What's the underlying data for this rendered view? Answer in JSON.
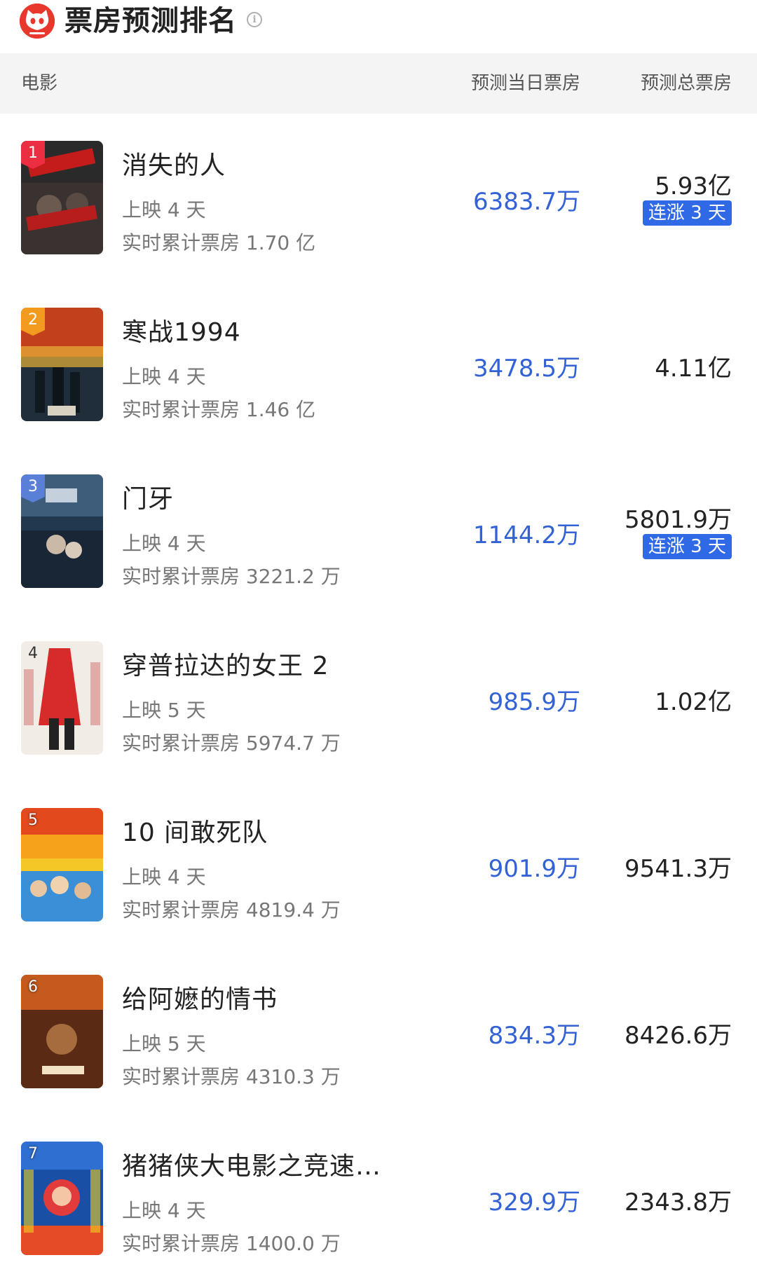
{
  "header": {
    "title": "票房预测排名",
    "info_icon": "info-icon"
  },
  "columns": {
    "movie": "电影",
    "day": "预测当日票房",
    "total": "预测总票房"
  },
  "colors": {
    "accent_blue": "#3262d6",
    "badge_blue": "#3069e6",
    "logo_red": "#e8372c"
  },
  "movies": [
    {
      "rank": "1",
      "name": "消失的人",
      "days": "上映 4 天",
      "cumulative": "实时累计票房 1.70 亿",
      "day_box": "6383.7万",
      "total_box": "5.93亿",
      "badge": "连涨 3 天"
    },
    {
      "rank": "2",
      "name": "寒战1994",
      "days": "上映 4 天",
      "cumulative": "实时累计票房 1.46 亿",
      "day_box": "3478.5万",
      "total_box": "4.11亿",
      "badge": ""
    },
    {
      "rank": "3",
      "name": "门牙",
      "days": "上映 4 天",
      "cumulative": "实时累计票房 3221.2 万",
      "day_box": "1144.2万",
      "total_box": "5801.9万",
      "badge": "连涨 3 天"
    },
    {
      "rank": "4",
      "name": "穿普拉达的女王 2",
      "days": "上映 5 天",
      "cumulative": "实时累计票房 5974.7 万",
      "day_box": "985.9万",
      "total_box": "1.02亿",
      "badge": ""
    },
    {
      "rank": "5",
      "name": "10 间敢死队",
      "days": "上映 4 天",
      "cumulative": "实时累计票房 4819.4 万",
      "day_box": "901.9万",
      "total_box": "9541.3万",
      "badge": ""
    },
    {
      "rank": "6",
      "name": "给阿嬷的情书",
      "days": "上映 5 天",
      "cumulative": "实时累计票房 4310.3 万",
      "day_box": "834.3万",
      "total_box": "8426.6万",
      "badge": ""
    },
    {
      "rank": "7",
      "name": "猪猪侠大电影之竞速…",
      "days": "上映 4 天",
      "cumulative": "实时累计票房 1400.0 万",
      "day_box": "329.9万",
      "total_box": "2343.8万",
      "badge": ""
    }
  ]
}
